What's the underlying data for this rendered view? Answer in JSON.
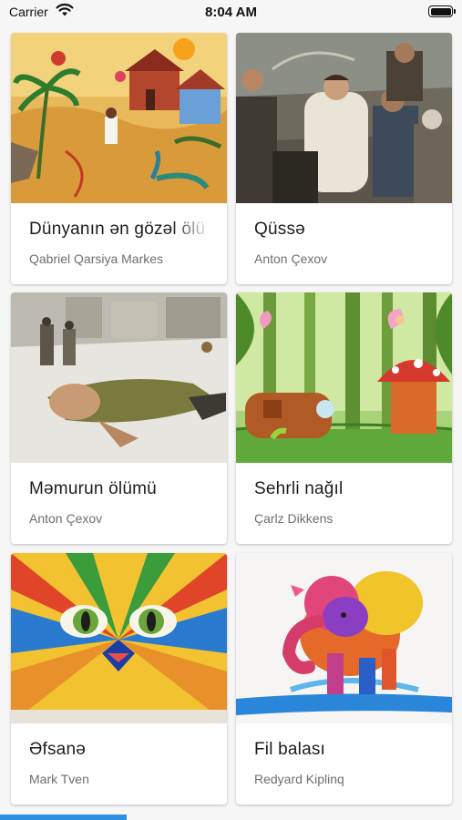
{
  "status_bar": {
    "carrier": "Carrier",
    "time": "8:04 AM"
  },
  "books": [
    {
      "title": "Dünyanın ən gözəl ölü",
      "author": "Qabriel Qarsiya Markes"
    },
    {
      "title": "Qüssə",
      "author": "Anton Çexov"
    },
    {
      "title": "Məmurun ölümü",
      "author": "Anton Çexov"
    },
    {
      "title": "Sehrli nağıl",
      "author": "Çarlz Dikkens"
    },
    {
      "title": "Əfsanə",
      "author": "Mark Tven"
    },
    {
      "title": "Fil balası",
      "author": "Redyard Kiplinq"
    }
  ],
  "colors": {
    "accent": "#2f8fe0",
    "background": "#f6f6f7"
  }
}
